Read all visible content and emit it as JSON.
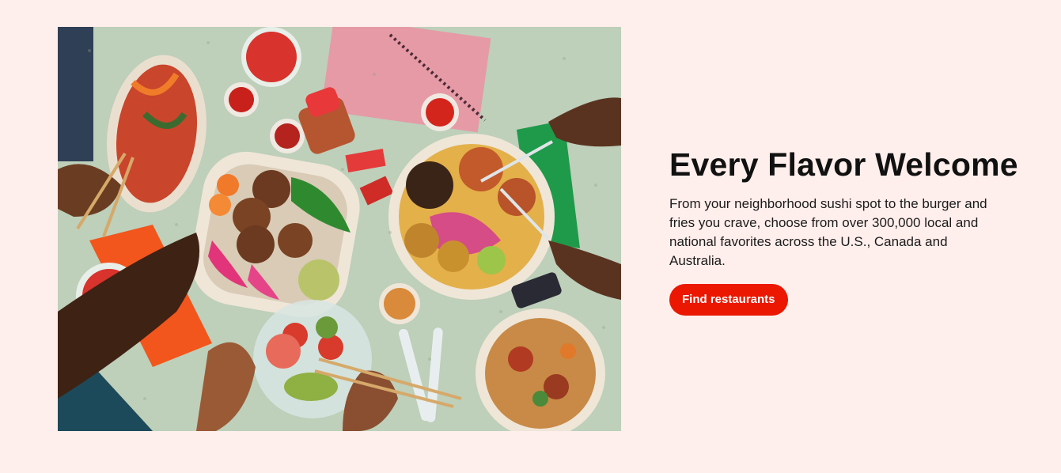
{
  "hero": {
    "title": "Every Flavor Welcome",
    "description": "From your neighborhood sushi spot to the burger and fries you crave, choose from over 300,000 local and national favorites across the U.S., Canada and Australia.",
    "cta_label": "Find restaurants"
  },
  "colors": {
    "page_background": "#FFEFEC",
    "accent": "#EB1700",
    "heading": "#111111"
  }
}
